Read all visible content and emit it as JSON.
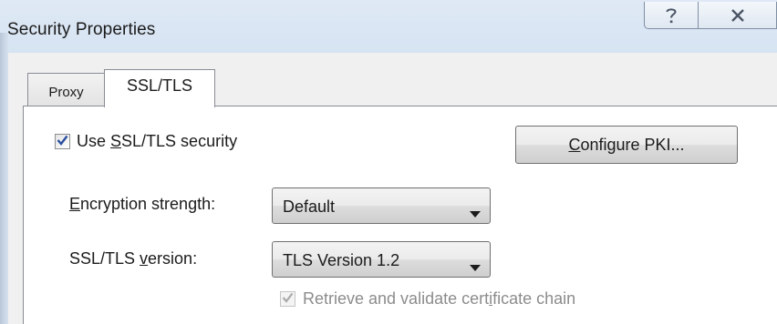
{
  "window": {
    "title": "Security Properties",
    "help_button": "question-icon",
    "close_button": "close-icon"
  },
  "tabs": [
    {
      "label": "Proxy",
      "selected": false
    },
    {
      "label": "SSL/TLS",
      "selected": true
    }
  ],
  "ssl": {
    "use_ssl": {
      "pre": "Use ",
      "mnemonic": "S",
      "post": "SL/TLS security",
      "checked": true
    },
    "configure_pki": {
      "mnemonic": "C",
      "post": "onfigure PKI..."
    },
    "encryption": {
      "mnemonic": "E",
      "post": "ncryption strength:",
      "value": "Default"
    },
    "version": {
      "pre": "SSL/TLS ",
      "mnemonic": "v",
      "post": "ersion:",
      "value": "TLS Version 1.2"
    },
    "chain": {
      "pre": "Retrieve and validate cert",
      "mnemonic": "i",
      "post": "ficate chain",
      "checked": true,
      "enabled": false
    }
  },
  "colors": {
    "accent_check": "#2a4fa0",
    "disabled_text": "#8c8c8c"
  }
}
